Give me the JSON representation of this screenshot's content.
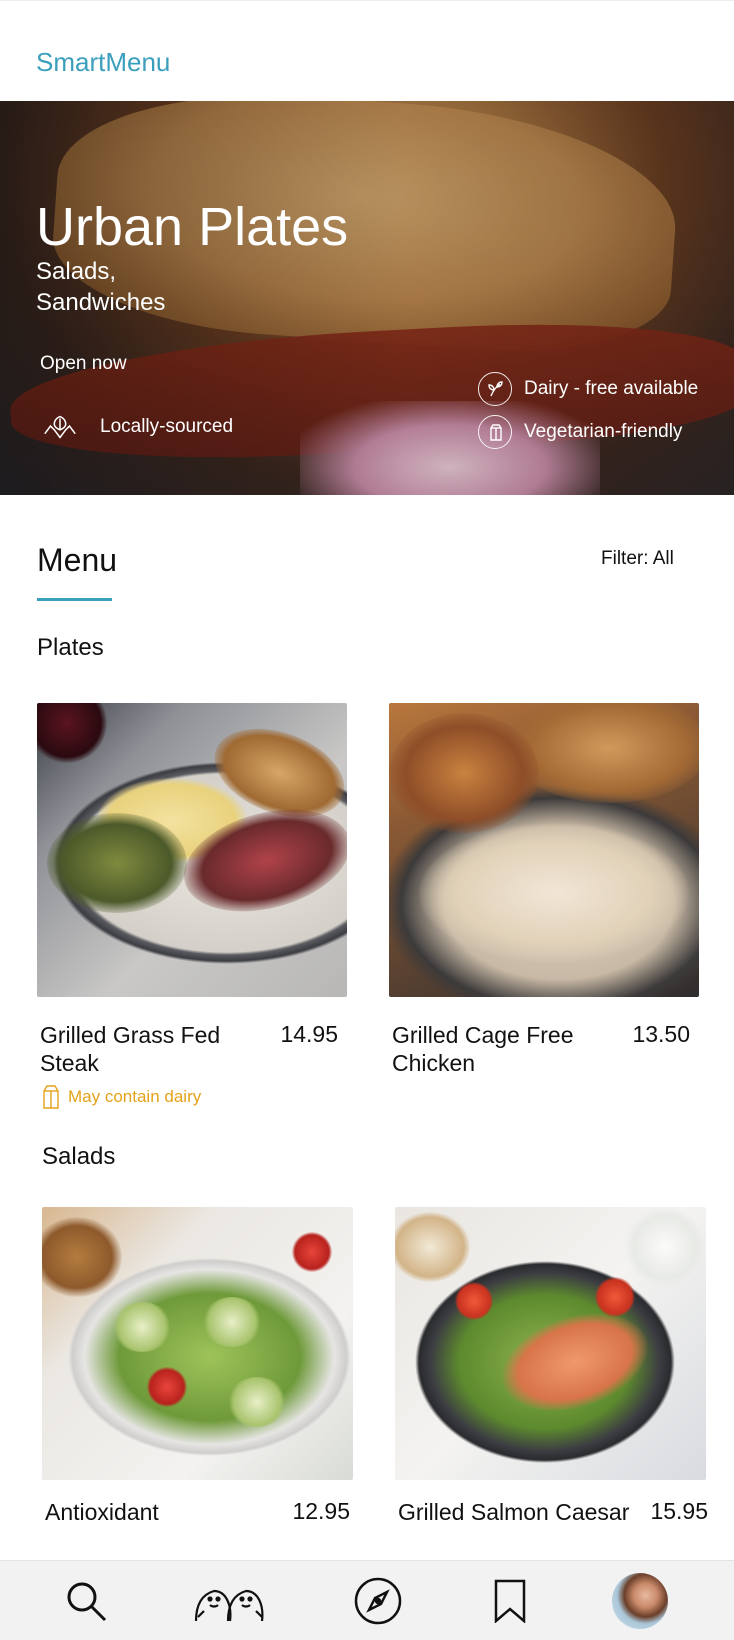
{
  "app": {
    "brand": "SmartMenu"
  },
  "restaurant": {
    "name": "Urban Plates",
    "cuisine": "Salads,\nSandwiches",
    "status": "Open now",
    "badges": {
      "local": "Locally-sourced",
      "dairy": "Dairy - free available",
      "veg": "Vegetarian-friendly"
    }
  },
  "menu": {
    "title": "Menu",
    "filter": "Filter: All",
    "sections": [
      {
        "title": "Plates",
        "items": [
          {
            "name": "Grilled Grass Fed Steak",
            "price": "14.95",
            "warning": "May contain dairy"
          },
          {
            "name": "Grilled Cage Free Chicken",
            "price": "13.50"
          }
        ]
      },
      {
        "title": "Salads",
        "items": [
          {
            "name": "Antioxidant",
            "price": "12.95"
          },
          {
            "name": "Grilled Salmon Caesar",
            "price": "15.95"
          }
        ]
      }
    ]
  },
  "nav": {
    "items": [
      "search-icon",
      "friends-icon",
      "compass-icon",
      "bookmark-icon",
      "profile-avatar"
    ]
  },
  "colors": {
    "accent": "#3a9fbd",
    "warning": "#e3a21a"
  }
}
